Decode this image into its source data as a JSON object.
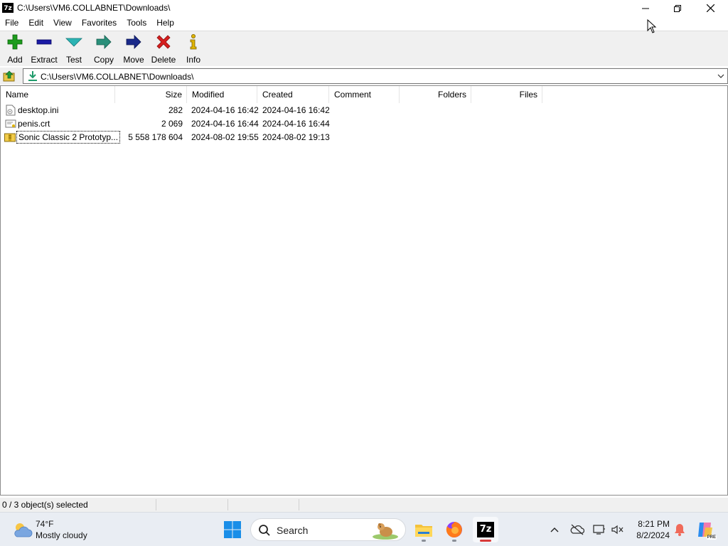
{
  "window": {
    "app_icon_text": "7z",
    "title": "C:\\Users\\VM6.COLLABNET\\Downloads\\"
  },
  "menu": [
    "File",
    "Edit",
    "View",
    "Favorites",
    "Tools",
    "Help"
  ],
  "toolbar": {
    "add": "Add",
    "extract": "Extract",
    "test": "Test",
    "copy": "Copy",
    "move": "Move",
    "delete": "Delete",
    "info": "Info"
  },
  "address": {
    "value": "C:\\Users\\VM6.COLLABNET\\Downloads\\"
  },
  "columns": {
    "name": "Name",
    "size": "Size",
    "modified": "Modified",
    "created": "Created",
    "comment": "Comment",
    "folders": "Folders",
    "files": "Files"
  },
  "files": [
    {
      "name": "desktop.ini",
      "size": "282",
      "modified": "2024-04-16 16:42",
      "created": "2024-04-16 16:42",
      "icon": "ini-file-icon"
    },
    {
      "name": "penis.crt",
      "size": "2 069",
      "modified": "2024-04-16 16:44",
      "created": "2024-04-16 16:44",
      "icon": "certificate-file-icon"
    },
    {
      "name": "Sonic Classic 2 Prototyp...",
      "size": "5 558 178 604",
      "modified": "2024-08-02 19:55",
      "created": "2024-08-02 19:13",
      "icon": "archive-file-icon"
    }
  ],
  "status": {
    "selection": "0 / 3 object(s) selected"
  },
  "taskbar": {
    "weather_temp": "74°F",
    "weather_desc": "Mostly cloudy",
    "search_label": "Search",
    "clock_time": "8:21 PM",
    "clock_date": "8/2/2024",
    "sevenzip_text": "7z",
    "copilot_badge": "PRE"
  },
  "colors": {
    "add_green": "#1c9b1c",
    "extract_blue": "#1a1aa6",
    "test_teal": "#2bb3b3",
    "delete_red": "#d61f1f",
    "accent_blue": "#0067c0"
  }
}
